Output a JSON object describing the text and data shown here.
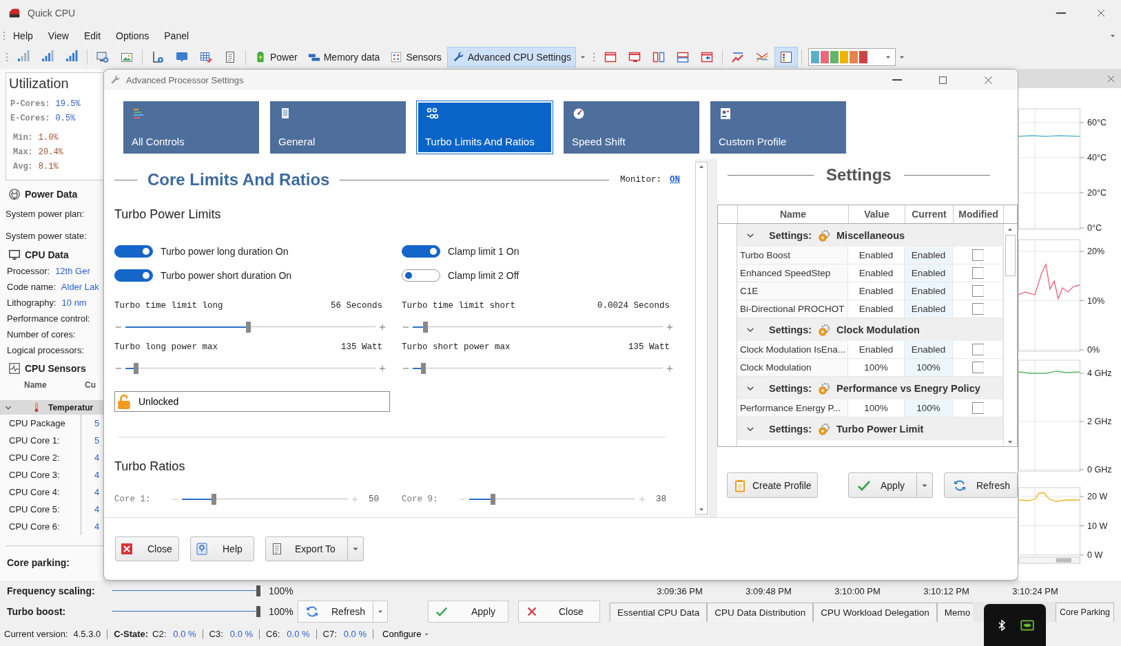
{
  "window": {
    "title": "Quick CPU"
  },
  "menu": [
    "Help",
    "View",
    "Edit",
    "Options",
    "Panel"
  ],
  "toolbar": {
    "groups": [
      [
        {
          "kind": "icon",
          "selected": false
        },
        {
          "kind": "icon",
          "selected": false
        },
        {
          "kind": "icon",
          "selected": false
        }
      ],
      [
        {
          "kind": "icon",
          "selected": false
        },
        {
          "kind": "icon",
          "selected": false
        }
      ],
      [
        {
          "kind": "icon",
          "selected": false
        },
        {
          "kind": "icon",
          "selected": false
        },
        {
          "kind": "icon",
          "selected": false
        },
        {
          "kind": "icon",
          "selected": false
        }
      ],
      [
        {
          "kind": "labeled",
          "label": "Power",
          "selected": false
        },
        {
          "kind": "labeled",
          "label": "Memory data",
          "selected": false
        },
        {
          "kind": "labeled",
          "label": "Sensors",
          "selected": false
        },
        {
          "kind": "labeled",
          "label": "Advanced CPU Settings",
          "selected": true
        },
        {
          "kind": "dropdown"
        }
      ],
      [
        {
          "kind": "icon",
          "selected": false
        },
        {
          "kind": "icon",
          "selected": false
        },
        {
          "kind": "icon",
          "selected": false
        },
        {
          "kind": "icon",
          "selected": false
        },
        {
          "kind": "icon",
          "selected": false
        }
      ],
      [
        {
          "kind": "icon",
          "selected": false
        },
        {
          "kind": "icon",
          "selected": false
        },
        {
          "kind": "icon",
          "selected": true
        }
      ]
    ],
    "palette": {
      "swatches": [
        {
          "color": "#5bb0c9"
        },
        {
          "color": "#e86a7a"
        },
        {
          "color": "#62b56a"
        },
        {
          "color": "#f0b400"
        },
        {
          "color": "#e8844a"
        },
        {
          "color": "#cc4444"
        }
      ]
    }
  },
  "utilization": {
    "title": "Utilization",
    "cores": [
      {
        "label": "P-Cores:",
        "value": "19.5%"
      },
      {
        "label": "E-Cores:",
        "value": "0.5%"
      }
    ],
    "stats": [
      {
        "label": "Min:",
        "value": "1.0%"
      },
      {
        "label": "Max:",
        "value": "20.4%"
      },
      {
        "label": "Avg:",
        "value": "8.1%"
      }
    ]
  },
  "power_data": {
    "title": "Power Data",
    "fields": [
      "System power plan:",
      "System power state:"
    ]
  },
  "cpu_data": {
    "title": "CPU Data",
    "fields": [
      {
        "label": "Processor:",
        "value": "12th Ger"
      },
      {
        "label": "Code name:",
        "value": "Alder Lak"
      },
      {
        "label": "Lithography:",
        "value": "10 nm"
      },
      {
        "label": "Performance control:"
      },
      {
        "label": "Number of cores:"
      },
      {
        "label": "Logical processors:"
      }
    ]
  },
  "cpu_sensors": {
    "title": "CPU Sensors",
    "columns": [
      "Name",
      "Cu"
    ],
    "groups": [
      {
        "label": "Temperatur",
        "expanded": true,
        "rows": [
          {
            "name": "CPU Package",
            "value": "5"
          },
          {
            "name": "CPU Core 1:",
            "value": "5"
          },
          {
            "name": "CPU Core 2:",
            "value": "4"
          },
          {
            "name": "CPU Core 3:",
            "value": "4"
          },
          {
            "name": "CPU Core 4:",
            "value": "4"
          },
          {
            "name": "CPU Core 5:",
            "value": "4"
          },
          {
            "name": "CPU Core 6:",
            "value": "4"
          }
        ]
      }
    ]
  },
  "core_parking": {
    "label": "Core parking:"
  },
  "dialog": {
    "title": "Advanced Processor Settings",
    "tiles": [
      {
        "label": "All Controls",
        "selected": false
      },
      {
        "label": "General",
        "selected": false
      },
      {
        "label": "Turbo Limits And Ratios",
        "selected": true
      },
      {
        "label": "Speed Shift",
        "selected": false
      },
      {
        "label": "Custom Profile",
        "selected": false
      }
    ],
    "section_title": "Core Limits And Ratios",
    "monitor": {
      "label": "Monitor:",
      "value": "ON"
    },
    "power_limits": {
      "title": "Turbo Power Limits",
      "toggles": [
        {
          "label": "Turbo power long duration On",
          "on": true
        },
        {
          "label": "Clamp limit 1 On",
          "on": true
        },
        {
          "label": "Turbo power short duration On",
          "on": true
        },
        {
          "label": "Clamp limit 2 Off",
          "on": false
        }
      ],
      "sliders": [
        {
          "label": "Turbo time limit long",
          "reading": "56 Seconds",
          "level": 0.49
        },
        {
          "label": "Turbo time limit short",
          "reading": "0.0024 Seconds",
          "level": 0.05
        },
        {
          "label": "Turbo long power max",
          "reading": "135 Watt",
          "level": 0.04
        },
        {
          "label": "Turbo short power max",
          "reading": "135 Watt",
          "level": 0.04
        }
      ],
      "lock": {
        "label": "Unlocked"
      }
    },
    "ratios": {
      "title": "Turbo Ratios",
      "cores": [
        {
          "label": "Core 1:",
          "level": 0.19,
          "value": "50"
        },
        {
          "label": "Core 9:",
          "level": 0.14,
          "value": "38"
        }
      ]
    },
    "settings": {
      "title": "Settings",
      "columns": [
        "Name",
        "Value",
        "Current",
        "Modified"
      ],
      "groups": [
        {
          "label": "Settings:",
          "name": "Miscellaneous",
          "expanded": true,
          "rows": [
            {
              "name": "Turbo Boost",
              "value": "Enabled",
              "current": "Enabled",
              "modified": false
            },
            {
              "name": "Enhanced SpeedStep",
              "value": "Enabled",
              "current": "Enabled",
              "modified": false
            },
            {
              "name": "C1E",
              "value": "Enabled",
              "current": "Enabled",
              "modified": false
            },
            {
              "name": "Bi-Directional PROCHOT",
              "value": "Enabled",
              "current": "Enabled",
              "modified": false
            }
          ]
        },
        {
          "label": "Settings:",
          "name": "Clock Modulation",
          "expanded": true,
          "rows": [
            {
              "name": "Clock Modulation IsEna...",
              "value": "Enabled",
              "current": "Enabled",
              "modified": false
            },
            {
              "name": "Clock Modulation",
              "value": "100%",
              "current": "100%",
              "modified": false
            }
          ]
        },
        {
          "label": "Settings:",
          "name": "Performance vs Enegry Policy",
          "expanded": true,
          "rows": [
            {
              "name": "Performance Energy P...",
              "value": "100%",
              "current": "100%",
              "modified": false
            }
          ]
        },
        {
          "label": "Settings:",
          "name": "Turbo Power Limit",
          "expanded": true
        }
      ]
    },
    "settings_buttons": [
      {
        "label": "Create Profile"
      },
      {
        "label": "Apply",
        "dropdown": true
      },
      {
        "label": "Refresh"
      }
    ],
    "buttons": [
      {
        "label": "Close"
      },
      {
        "label": "Help"
      },
      {
        "label": "Export To",
        "dropdown": true
      }
    ]
  },
  "graphs": [
    {
      "ticks": [
        "60°C",
        "40°C",
        "20°C",
        "0°C"
      ]
    },
    {
      "ticks": [
        "20%",
        "10%",
        "0%"
      ]
    },
    {
      "ticks": [
        "4 GHz",
        "2 GHz",
        "0 GHz"
      ]
    },
    {
      "ticks": [
        "20 W",
        "10 W",
        "0 W"
      ]
    }
  ],
  "bottom": {
    "sliders": [
      {
        "label": "Frequency scaling:",
        "level": 1,
        "reading": "100%"
      },
      {
        "label": "Turbo boost:",
        "level": 1,
        "reading": "100%"
      }
    ],
    "buttons": [
      {
        "label": "Refresh",
        "dropdown": true
      },
      {
        "label": "Apply"
      },
      {
        "label": "Close"
      }
    ],
    "time_axis": [
      "3:09:36 PM",
      "3:09:48 PM",
      "3:10:00 PM",
      "3:10:12 PM",
      "3:10:24 PM"
    ],
    "tabs": [
      {
        "label": "Essential CPU Data",
        "selected": false
      },
      {
        "label": "CPU Data Distribution",
        "selected": false
      },
      {
        "label": "CPU Workload Delegation",
        "selected": false
      },
      {
        "label": "Memo",
        "selected": false
      },
      {
        "label": "Core Parking",
        "selected": false
      }
    ]
  },
  "status_bar": {
    "version_label": "Current version:",
    "version": "4.5.3.0",
    "cstate_label": "C-State:",
    "cstates": [
      {
        "label": "C2:",
        "value": "0.0 %"
      },
      {
        "label": "C3:",
        "value": "0.0 %"
      },
      {
        "label": "C6:",
        "value": "0.0 %"
      },
      {
        "label": "C7:",
        "value": "0.0 %"
      }
    ],
    "configure": "Configure"
  }
}
